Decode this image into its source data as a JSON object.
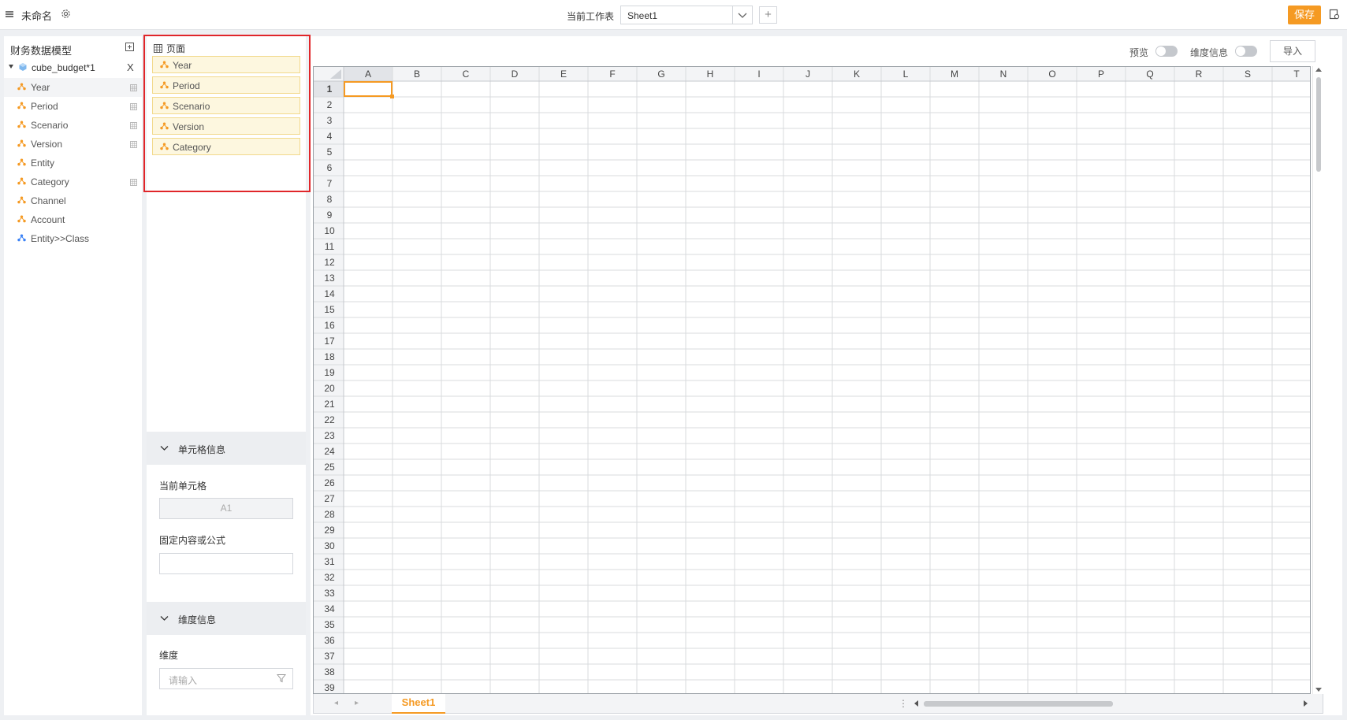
{
  "header": {
    "title": "未命名",
    "sheet_label": "当前工作表",
    "current_sheet": "Sheet1",
    "add_symbol": "+",
    "save_label": "保存"
  },
  "left_panel": {
    "title": "财务数据模型",
    "cube": {
      "name": "cube_budget*1",
      "close_symbol": "X"
    },
    "dimensions": [
      {
        "label": "Year",
        "has_grid_icon": true,
        "active": true
      },
      {
        "label": "Period",
        "has_grid_icon": true
      },
      {
        "label": "Scenario",
        "has_grid_icon": true
      },
      {
        "label": "Version",
        "has_grid_icon": true
      },
      {
        "label": "Entity",
        "has_grid_icon": false
      },
      {
        "label": "Category",
        "has_grid_icon": true
      },
      {
        "label": "Channel",
        "has_grid_icon": false
      },
      {
        "label": "Account",
        "has_grid_icon": false
      },
      {
        "label": "Entity>>Class",
        "has_grid_icon": false,
        "icon_color": "#3b82f6"
      }
    ]
  },
  "page_section": {
    "title": "页面",
    "items": [
      "Year",
      "Period",
      "Scenario",
      "Version",
      "Category"
    ]
  },
  "cell_info": {
    "title": "单元格信息",
    "current_cell_label": "当前单元格",
    "current_cell_value": "A1",
    "formula_label": "固定内容或公式",
    "formula_value": ""
  },
  "dimension_info": {
    "title": "维度信息",
    "dimension_label": "维度",
    "dimension_placeholder": "请输入"
  },
  "toolbar": {
    "preview_label": "预览",
    "dim_info_label": "维度信息",
    "import_label": "导入"
  },
  "spreadsheet": {
    "columns": [
      "A",
      "B",
      "C",
      "D",
      "E",
      "F",
      "G",
      "H",
      "I",
      "J",
      "K",
      "L",
      "M",
      "N",
      "O",
      "P",
      "Q",
      "R",
      "S",
      "T"
    ],
    "row_count": 39,
    "selected_cell": "A1",
    "tabs": [
      "Sheet1"
    ],
    "selection_color": "#f59a23"
  },
  "colors": {
    "accent": "#f59a23",
    "highlight_border": "#e0262a",
    "chip_bg": "#fdf7df",
    "dim_icon": "#f59a23"
  }
}
